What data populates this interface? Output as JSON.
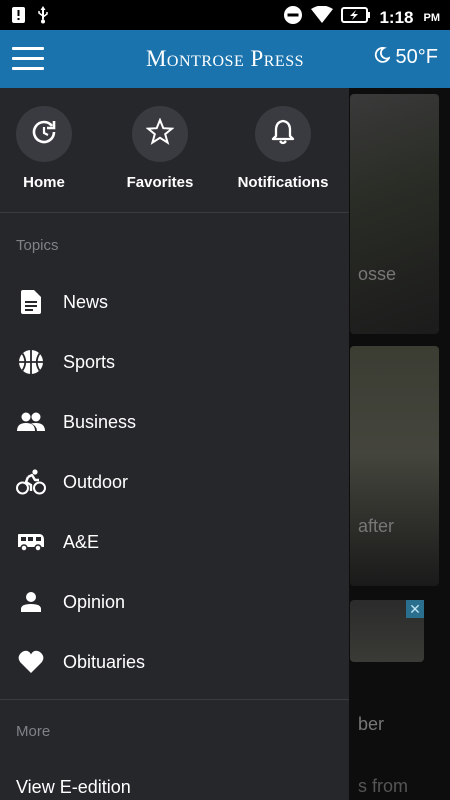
{
  "status_bar": {
    "time": "1:18",
    "ampm": "PM"
  },
  "header": {
    "logo": "Montrose Press",
    "temperature": "50°F"
  },
  "drawer": {
    "quick_actions": [
      {
        "label": "Home",
        "icon": "home-refresh-icon"
      },
      {
        "label": "Favorites",
        "icon": "star-icon"
      },
      {
        "label": "Notifications",
        "icon": "bell-icon"
      }
    ],
    "topics_title": "Topics",
    "topics": [
      {
        "label": "News",
        "icon": "document-icon"
      },
      {
        "label": "Sports",
        "icon": "basketball-icon"
      },
      {
        "label": "Business",
        "icon": "people-icon"
      },
      {
        "label": "Outdoor",
        "icon": "cyclist-icon"
      },
      {
        "label": "A&E",
        "icon": "rv-icon"
      },
      {
        "label": "Opinion",
        "icon": "person-icon"
      },
      {
        "label": "Obituaries",
        "icon": "heart-icon"
      }
    ],
    "more_title": "More",
    "more_items": [
      {
        "label": "View E-edition"
      }
    ]
  },
  "feed": {
    "snippets": [
      "osse",
      "after",
      "ber",
      "s from"
    ]
  }
}
